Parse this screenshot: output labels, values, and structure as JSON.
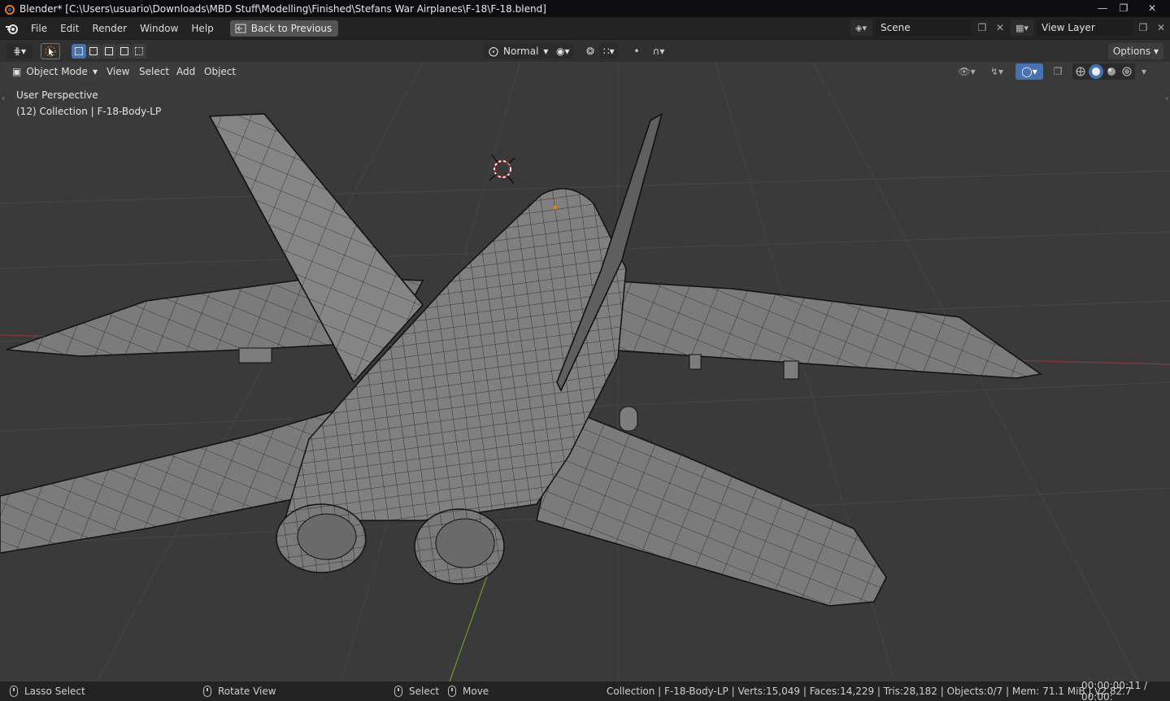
{
  "window": {
    "title": "Blender* [C:\\Users\\usuario\\Downloads\\MBD Stuff\\Modelling\\Finished\\Stefans War Airplanes\\F-18\\F-18.blend]",
    "controls": [
      "minimize-icon",
      "maximize-icon",
      "close-icon"
    ]
  },
  "menubar": {
    "items": [
      "File",
      "Edit",
      "Render",
      "Window",
      "Help"
    ],
    "back_button": "Back to Previous",
    "scene_name": "Scene",
    "view_layer_name": "View Layer"
  },
  "toolheader": {
    "orientation": "Normal",
    "options_label": "Options",
    "icons": [
      "editor-type-icon",
      "select-tool-icon",
      "select-set-icon",
      "select-extend-icon",
      "select-subtract-icon",
      "select-invert-icon",
      "select-intersect-icon",
      "orientation-icon",
      "pivot-icon",
      "snap-icon",
      "snap-grid-icon",
      "proportional-icon",
      "falloff-icon"
    ]
  },
  "viewport": {
    "mode": "Object Mode",
    "menus": [
      "View",
      "Select",
      "Add",
      "Object"
    ],
    "info_line1": "User Perspective",
    "info_line2": "(12) Collection | F-18-Body-LP",
    "shading_icons": [
      "visibility-icon",
      "gizmo-icon",
      "overlay-icon",
      "xray-icon",
      "wireframe-shading-icon",
      "solid-shading-icon",
      "material-shading-icon",
      "rendered-shading-icon"
    ]
  },
  "statusbar": {
    "lasso_select": "Lasso Select",
    "rotate_view": "Rotate View",
    "select": "Select",
    "move": "Move",
    "stats": "Collection | F-18-Body-LP | Verts:15,049 | Faces:14,229 | Tris:28,182 | Objects:0/7 | Mem: 71.1 MiB | v2.82.7",
    "time": "00:00:00:11 / 00:00:"
  },
  "colors": {
    "accent": "#4772b3",
    "viewport_bg": "#3a3a3a",
    "x_axis": "#a0343e",
    "y_axis": "#6f9b24"
  }
}
